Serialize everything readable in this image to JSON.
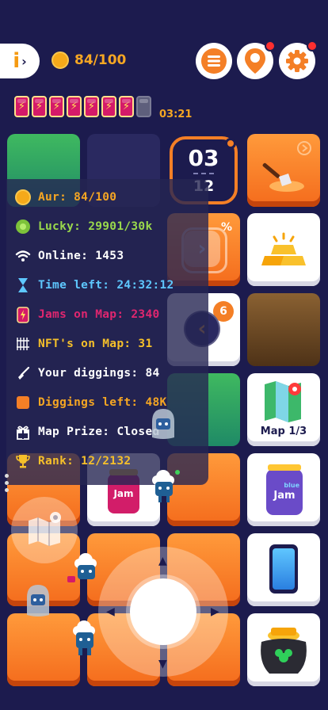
{
  "header": {
    "coins_text": "84/100",
    "energy_cells_full": 7,
    "energy_cells_total": 8,
    "energy_timer": "03:21"
  },
  "center_timer": {
    "mins": "03",
    "secs": "12"
  },
  "stats": [
    {
      "label": "Aur: 84/100",
      "icon": "coin-icon",
      "color": "#f5a623"
    },
    {
      "label": "Lucky: 29901/30k",
      "icon": "clover-coin-icon",
      "color": "#9ad94c"
    },
    {
      "label": "Online: 1453",
      "icon": "wifi-icon",
      "color": "#ffffff"
    },
    {
      "label": "Time left: 24:32:12",
      "icon": "hourglass-icon",
      "color": "#5ec7ff"
    },
    {
      "label": "Jams on Map: 2340",
      "icon": "jam-energy-icon",
      "color": "#e0266f"
    },
    {
      "label": "NFT's on Map: 31",
      "icon": "nft-grid-icon",
      "color": "#f6c02a"
    },
    {
      "label": "Your diggings: 84",
      "icon": "shovel-icon",
      "color": "#ffffff"
    },
    {
      "label": "Diggings left: 48K",
      "icon": "square-icon",
      "color": "#f5a623"
    },
    {
      "label": "Map Prize: Closed",
      "icon": "gift-icon",
      "color": "#ffffff"
    },
    {
      "label": "Rank: 12/2132",
      "icon": "trophy-icon",
      "color": "#f6c02a"
    }
  ],
  "tiles": {
    "percent_symbol": "%",
    "badge_count": "6",
    "map_label": "Map 1/3",
    "jam_label": "Jam",
    "blue_jam_small": "blue",
    "blue_jam_label": "Jam"
  },
  "colors": {
    "background": "#1c1b4e",
    "accent_orange": "#f47f26",
    "white_tile": "#ffffff"
  }
}
